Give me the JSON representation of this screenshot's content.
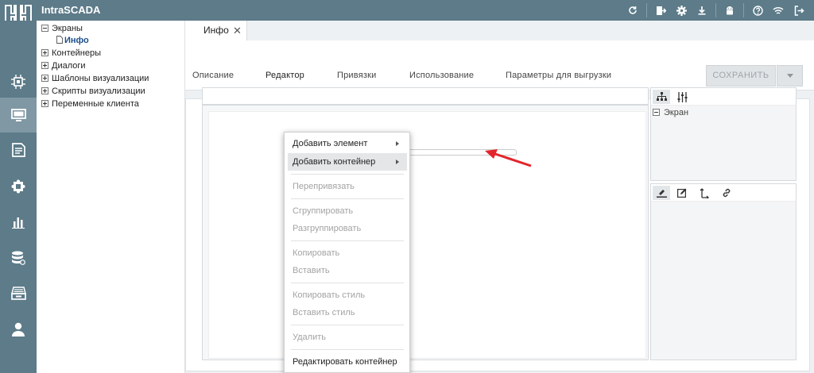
{
  "app": {
    "title": "IntraSCADA"
  },
  "topbar": {
    "icons": [
      "refresh-icon",
      "import-export-icon",
      "gear-icon",
      "download-icon",
      "android-icon",
      "help-icon",
      "wifi-icon",
      "logout-icon"
    ]
  },
  "rail": {
    "items": [
      "cpu-chip-icon",
      "monitor-icon",
      "document-icon",
      "puzzle-icon",
      "bar-chart-icon",
      "database-icon",
      "archive-tray-icon",
      "user-icon"
    ],
    "active_index": 1
  },
  "tree": {
    "items": [
      {
        "label": "Экраны",
        "expanded": true,
        "children": [
          "Инфо"
        ]
      },
      {
        "label": "Контейнеры",
        "expanded": false
      },
      {
        "label": "Диалоги",
        "expanded": false
      },
      {
        "label": "Шаблоны визуализации",
        "expanded": false
      },
      {
        "label": "Скрипты визуализации",
        "expanded": false
      },
      {
        "label": "Переменные клиента",
        "expanded": false
      }
    ]
  },
  "document_tab": {
    "label": "Инфо",
    "close": "✕"
  },
  "subtabs": [
    {
      "label": "Описание"
    },
    {
      "label": "Редактор",
      "active": true
    },
    {
      "label": "Привязки"
    },
    {
      "label": "Использование"
    },
    {
      "label": "Параметры для выгрузки"
    }
  ],
  "save_button": {
    "label": "СОХРАНИТЬ",
    "enabled": false
  },
  "structure_panel": {
    "root_label": "Экран"
  },
  "context_menu": {
    "items": [
      {
        "label": "Добавить элемент",
        "submenu": true
      },
      {
        "label": "Добавить контейнер",
        "submenu": true,
        "highlighted": true
      },
      {
        "label": "Перепривязать",
        "disabled": true
      },
      {
        "label": "Сгруппировать",
        "disabled": true
      },
      {
        "label": "Разгруппировать",
        "disabled": true
      },
      {
        "label": "Копировать",
        "disabled": true
      },
      {
        "label": "Вставить",
        "disabled": true
      },
      {
        "label": "Копировать стиль",
        "disabled": true
      },
      {
        "label": "Вставить стиль",
        "disabled": true
      },
      {
        "label": "Удалить",
        "disabled": true
      },
      {
        "label": "Редактировать контейнер"
      }
    ]
  },
  "colors": {
    "chrome": "#5d7b89",
    "annotation_arrow": "#e3252b"
  }
}
